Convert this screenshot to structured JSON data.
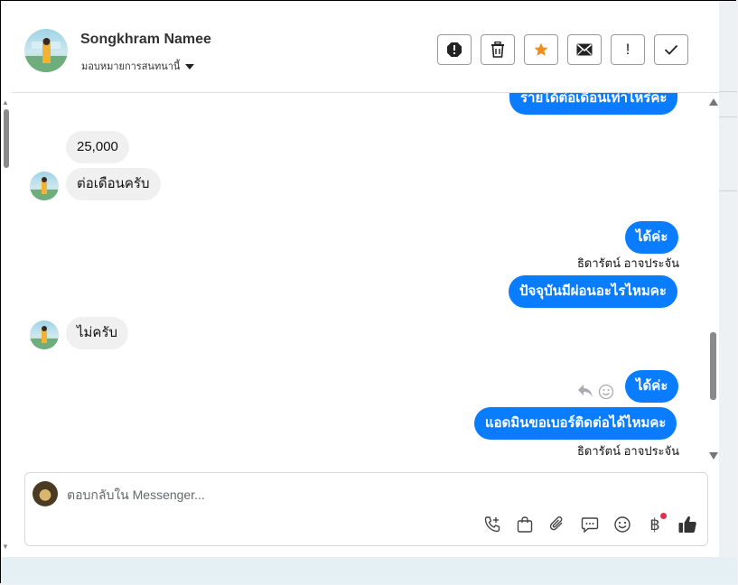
{
  "header": {
    "contact_name": "Songkhram Namee",
    "assign_label": "มอบหมายการสนทนานี้",
    "actions": [
      {
        "icon": "spam-icon"
      },
      {
        "icon": "trash-icon"
      },
      {
        "icon": "star-icon"
      },
      {
        "icon": "mail-icon"
      },
      {
        "icon": "alert-icon"
      },
      {
        "icon": "check-icon"
      }
    ],
    "alert_glyph": "!"
  },
  "messages": {
    "m0": "รายได้ต่อเดือนเท่าไหร่คะ",
    "m1": "25,000",
    "m2": "ต่อเดือนครับ",
    "m3": "ได้ค่ะ",
    "sender_a": "ธิดารัตน์ อาจประจัน",
    "m4": "ปัจจุบันมีผ่อนอะไรไหมคะ",
    "m5": "ไม่ครับ",
    "m6": "ได้ค่ะ",
    "m7": "แอดมินขอเบอร์ติดต่อได้ไหมคะ",
    "sender_b": "ธิดารัตน์ อาจประจัน"
  },
  "composer": {
    "placeholder": "ตอบกลับใน Messenger...",
    "tools": [
      "phone-add-icon",
      "shopping-bag-icon",
      "paperclip-icon",
      "chat-bubble-icon",
      "emoji-icon",
      "baht-icon",
      "thumbs-up-icon"
    ],
    "baht_glyph": "฿"
  },
  "colors": {
    "outgoing_bubble": "#0a7cff",
    "incoming_bubble": "#f0f0f0",
    "star": "#f28c1f",
    "notify_dot": "#e0314b"
  }
}
